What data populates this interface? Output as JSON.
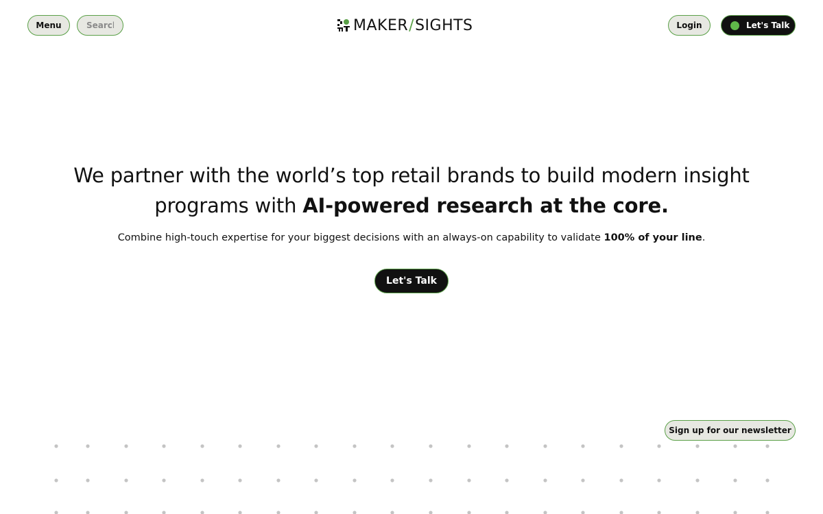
{
  "header": {
    "menu_label": "Menu",
    "search_placeholder": "Search",
    "logo": {
      "left": "MAKER",
      "slash": "/",
      "right": "SIGHTS"
    },
    "login_label": "Login",
    "talk_label": "Let's Talk"
  },
  "hero": {
    "title_part1": "We partner with the world’s top retail brands to build modern insight programs with ",
    "title_strong": "AI-powered research at the core",
    "title_end": ".",
    "subtitle_part1": "Combine high-touch expertise for your biggest decisions with an always-on capability to validate ",
    "subtitle_strong": "100% of your line",
    "subtitle_end": ".",
    "cta_label": "Let's Talk"
  },
  "footer": {
    "newsletter_label": "Sign up for our newsletter"
  },
  "colors": {
    "accent_green": "#5aa047",
    "dot_green": "#5fb849",
    "pill_bg": "#e7e8e2",
    "dark": "#111111",
    "grid_dot": "#c4c4c4"
  },
  "icons": {
    "logo_mark": "makersights-logo-icon",
    "status_dot": "green-dot-icon"
  }
}
